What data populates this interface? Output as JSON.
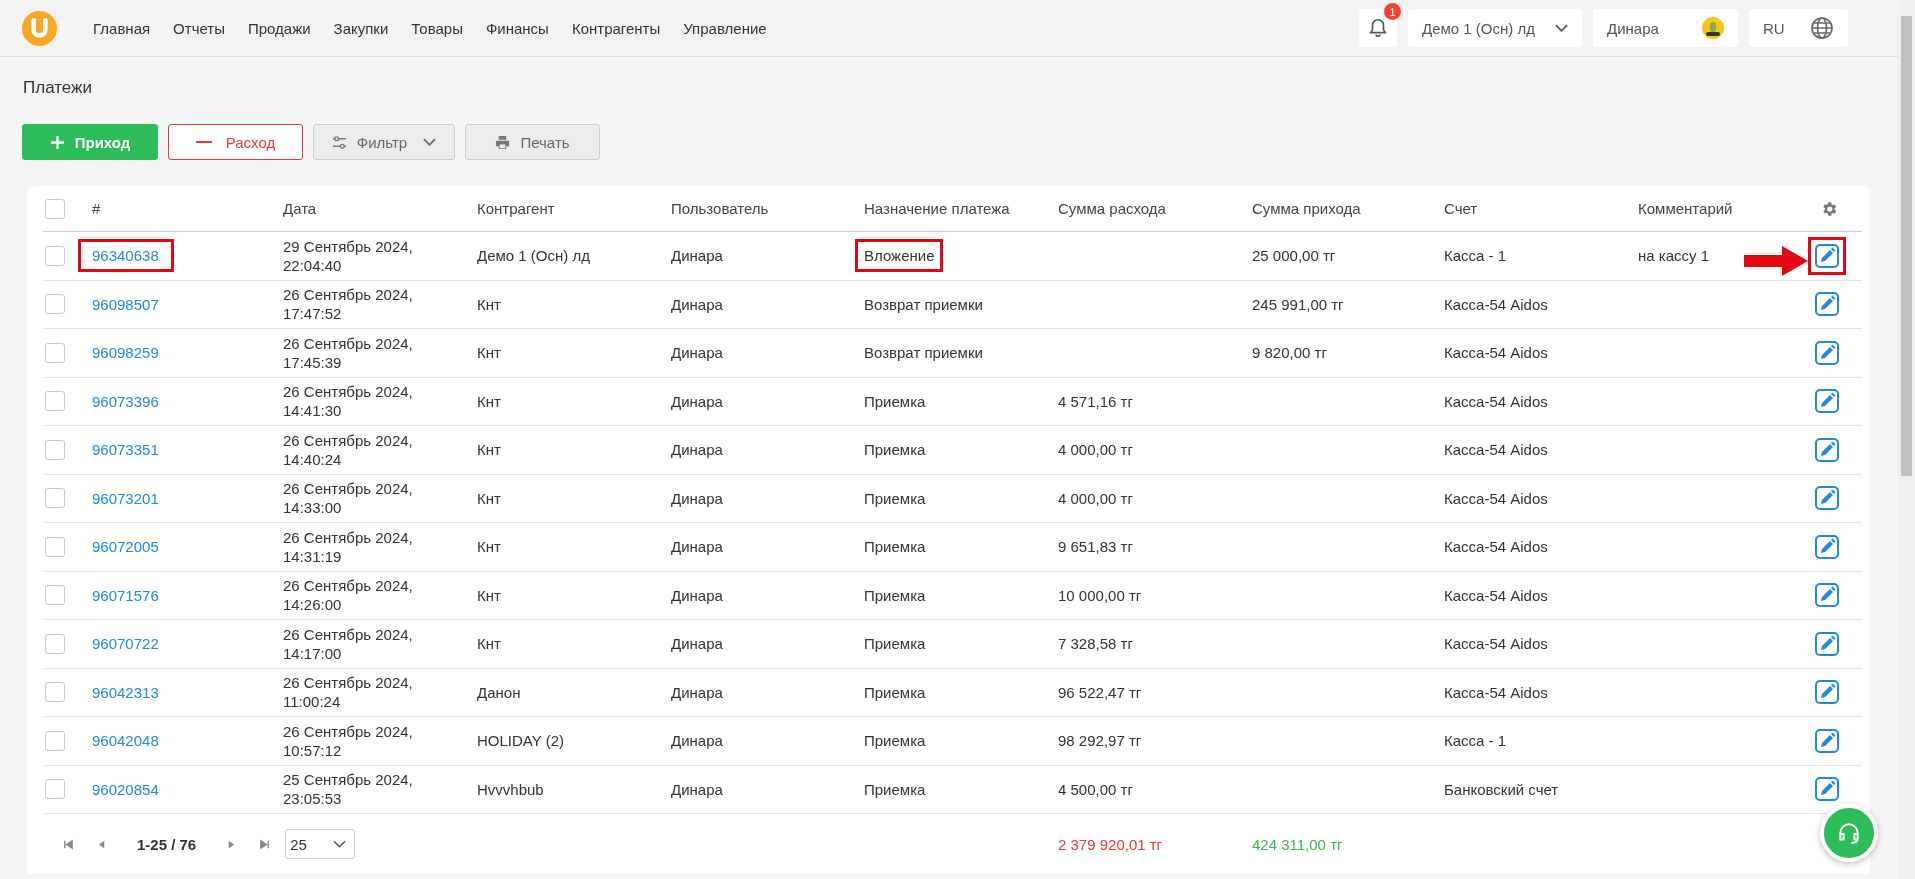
{
  "nav": {
    "items": [
      "Главная",
      "Отчеты",
      "Продажи",
      "Закупки",
      "Товары",
      "Финансы",
      "Контрагенты",
      "Управление"
    ],
    "notifications": {
      "count": "1"
    },
    "company": "Демо 1 (Осн) лд",
    "user": "Динара",
    "language": "RU"
  },
  "page_title": "Платежи",
  "toolbar": [
    {
      "kind": "income",
      "label": "Приход"
    },
    {
      "kind": "expense",
      "label": "Расход"
    },
    {
      "kind": "filter",
      "label": "Фильтр"
    },
    {
      "kind": "print",
      "label": "Печать"
    }
  ],
  "table": {
    "select_all": {
      "checked": false
    },
    "columns": [
      "#",
      "Дата",
      "Контрагент",
      "Пользователь",
      "Назначение платежа",
      "Сумма расхода",
      "Сумма прихода",
      "Счет",
      "Комментарий"
    ],
    "rows": [
      {
        "checked": false,
        "highlighted": true,
        "id": "96340638",
        "date": "29 Сентябрь 2024,",
        "time": "22:04:40",
        "counterparty": "Демо 1 (Осн) лд",
        "user": "Динара",
        "purpose": "Вложение",
        "expense": "",
        "income": "25 000,00 тг",
        "account": "Касса - 1",
        "comment": "на кассу 1"
      },
      {
        "checked": false,
        "highlighted": false,
        "id": "96098507",
        "date": "26 Сентябрь 2024,",
        "time": "17:47:52",
        "counterparty": "Кнт",
        "user": "Динара",
        "purpose": "Возврат приемки",
        "expense": "",
        "income": "245 991,00 тг",
        "account": "Касса-54 Aidos",
        "comment": ""
      },
      {
        "checked": false,
        "highlighted": false,
        "id": "96098259",
        "date": "26 Сентябрь 2024,",
        "time": "17:45:39",
        "counterparty": "Кнт",
        "user": "Динара",
        "purpose": "Возврат приемки",
        "expense": "",
        "income": "9 820,00 тг",
        "account": "Касса-54 Aidos",
        "comment": ""
      },
      {
        "checked": false,
        "highlighted": false,
        "id": "96073396",
        "date": "26 Сентябрь 2024,",
        "time": "14:41:30",
        "counterparty": "Кнт",
        "user": "Динара",
        "purpose": "Приемка",
        "expense": "4 571,16 тг",
        "income": "",
        "account": "Касса-54 Aidos",
        "comment": ""
      },
      {
        "checked": false,
        "highlighted": false,
        "id": "96073351",
        "date": "26 Сентябрь 2024,",
        "time": "14:40:24",
        "counterparty": "Кнт",
        "user": "Динара",
        "purpose": "Приемка",
        "expense": "4 000,00 тг",
        "income": "",
        "account": "Касса-54 Aidos",
        "comment": ""
      },
      {
        "checked": false,
        "highlighted": false,
        "id": "96073201",
        "date": "26 Сентябрь 2024,",
        "time": "14:33:00",
        "counterparty": "Кнт",
        "user": "Динара",
        "purpose": "Приемка",
        "expense": "4 000,00 тг",
        "income": "",
        "account": "Касса-54 Aidos",
        "comment": ""
      },
      {
        "checked": false,
        "highlighted": false,
        "id": "96072005",
        "date": "26 Сентябрь 2024,",
        "time": "14:31:19",
        "counterparty": "Кнт",
        "user": "Динара",
        "purpose": "Приемка",
        "expense": "9 651,83 тг",
        "income": "",
        "account": "Касса-54 Aidos",
        "comment": ""
      },
      {
        "checked": false,
        "highlighted": false,
        "id": "96071576",
        "date": "26 Сентябрь 2024,",
        "time": "14:26:00",
        "counterparty": "Кнт",
        "user": "Динара",
        "purpose": "Приемка",
        "expense": "10 000,00 тг",
        "income": "",
        "account": "Касса-54 Aidos",
        "comment": ""
      },
      {
        "checked": false,
        "highlighted": false,
        "id": "96070722",
        "date": "26 Сентябрь 2024,",
        "time": "14:17:00",
        "counterparty": "Кнт",
        "user": "Динара",
        "purpose": "Приемка",
        "expense": "7 328,58 тг",
        "income": "",
        "account": "Касса-54 Aidos",
        "comment": ""
      },
      {
        "checked": false,
        "highlighted": false,
        "id": "96042313",
        "date": "26 Сентябрь 2024,",
        "time": "11:00:24",
        "counterparty": "Данон",
        "user": "Динара",
        "purpose": "Приемка",
        "expense": "96 522,47 тг",
        "income": "",
        "account": "Касса-54 Aidos",
        "comment": ""
      },
      {
        "checked": false,
        "highlighted": false,
        "id": "96042048",
        "date": "26 Сентябрь 2024,",
        "time": "10:57:12",
        "counterparty": "HOLIDAY (2)",
        "user": "Динара",
        "purpose": "Приемка",
        "expense": "98 292,97 тг",
        "income": "",
        "account": "Касса - 1",
        "comment": ""
      },
      {
        "checked": false,
        "highlighted": false,
        "id": "96020854",
        "date": "25 Сентябрь 2024,",
        "time": "23:05:53",
        "counterparty": "Hvvvhbub",
        "user": "Динара",
        "purpose": "Приемка",
        "expense": "4 500,00 тг",
        "income": "",
        "account": "Банковский счет",
        "comment": ""
      }
    ]
  },
  "footer": {
    "range": "1-25 / 76",
    "page_size": "25",
    "total_expense": "2 379 920,01 тг",
    "total_income": "424 311,00 тг"
  }
}
